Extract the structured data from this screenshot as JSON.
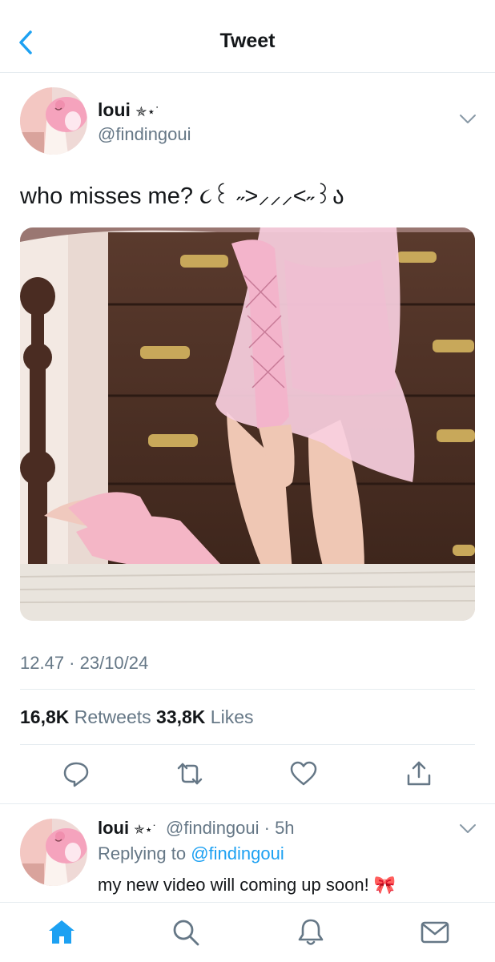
{
  "header": {
    "title": "Tweet"
  },
  "tweet": {
    "display_name": "loui",
    "name_decoration": "✯⋆˙",
    "handle": "@findingoui",
    "text": "who misses me? ૮꒰ ˶>⸝⸝⸝<˶꒱ა",
    "timestamp": "12.47 · 23/10/24",
    "retweets_count": "16,8K",
    "retweets_label": "Retweets",
    "likes_count": "33,8K",
    "likes_label": "Likes"
  },
  "reply": {
    "display_name": "loui",
    "name_decoration": "✯⋆˙",
    "handle_time": "@findingoui · 5h",
    "replying_prefix": "Replying to",
    "replying_handle": "@findingoui",
    "text": "my new video will coming up soon! 🎀"
  },
  "icons": {
    "back": "chevron-left-icon",
    "more": "chevron-down-icon",
    "reply": "speech-bubble-icon",
    "retweet": "retweet-icon",
    "like": "heart-icon",
    "share": "share-icon",
    "nav": [
      "home-icon",
      "search-icon",
      "bell-icon",
      "mail-icon"
    ]
  },
  "colors": {
    "accent": "#1da1f2",
    "text": "#14171a",
    "secondary": "#657786",
    "divider": "#e6ecf0"
  }
}
